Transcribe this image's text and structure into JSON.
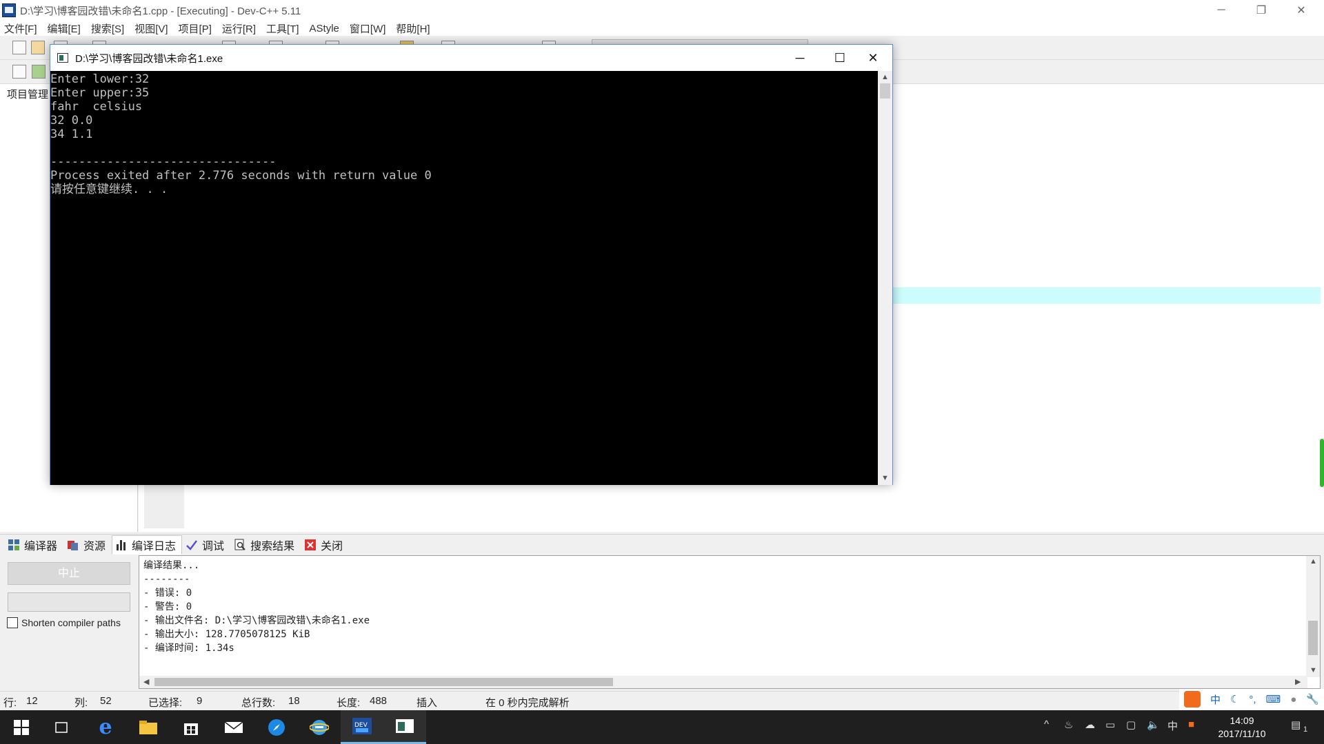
{
  "window": {
    "title": "D:\\学习\\博客园改错\\未命名1.cpp - [Executing] - Dev-C++ 5.11",
    "minimize_label": "─",
    "restore_label": "❐",
    "close_label": "✕"
  },
  "menu": [
    {
      "label": "文件[F]"
    },
    {
      "label": "编辑[E]"
    },
    {
      "label": "搜索[S]"
    },
    {
      "label": "视图[V]"
    },
    {
      "label": "项目[P]"
    },
    {
      "label": "运行[R]"
    },
    {
      "label": "工具[T]"
    },
    {
      "label": "AStyle"
    },
    {
      "label": "窗口[W]"
    },
    {
      "label": "帮助[H]"
    }
  ],
  "left_panel": {
    "tab_label": "项目管理"
  },
  "console": {
    "title": "D:\\学习\\博客园改错\\未命名1.exe",
    "minimize_label": "─",
    "maximize_label": "☐",
    "close_label": "✕",
    "output": "Enter lower:32\nEnter upper:35\nfahr  celsius\n32 0.0\n34 1.1\n\n--------------------------------\nProcess exited after 2.776 seconds with return value 0\n请按任意键继续. . ."
  },
  "bottom_tabs": [
    {
      "label": "编译器",
      "icon": "grid-icon"
    },
    {
      "label": "资源",
      "icon": "resources-icon"
    },
    {
      "label": "编译日志",
      "icon": "bar-chart-icon"
    },
    {
      "label": "调试",
      "icon": "check-icon"
    },
    {
      "label": "搜索结果",
      "icon": "search-doc-icon"
    },
    {
      "label": "关闭",
      "icon": "close-red-icon"
    }
  ],
  "compile_panel": {
    "abort_label": "中止",
    "shorten_paths_label": "Shorten compiler paths",
    "log": "编译结果...\n--------\n- 错误: 0\n- 警告: 0\n- 输出文件名: D:\\学习\\博客园改错\\未命名1.exe\n- 输出大小: 128.7705078125 KiB\n- 编译时间: 1.34s"
  },
  "status": {
    "line_label": "行:",
    "line_value": "12",
    "col_label": "列:",
    "col_value": "52",
    "sel_label": "已选择:",
    "sel_value": "9",
    "lines_label": "总行数:",
    "lines_value": "18",
    "len_label": "长度:",
    "len_value": "488",
    "mode": "插入",
    "parse_msg": "在 0 秒内完成解析"
  },
  "ime": {
    "lang": "中"
  },
  "taskbar": {
    "tray_lang": "中",
    "time": "14:09",
    "date": "2017/11/10",
    "notification_count": "1"
  },
  "colors": {
    "console_bg": "#000000",
    "console_fg": "#c0c0c0",
    "editor_highlight": "#ccfcfc",
    "taskbar_bg": "#1f1f1f",
    "accent": "#76b9ed"
  }
}
